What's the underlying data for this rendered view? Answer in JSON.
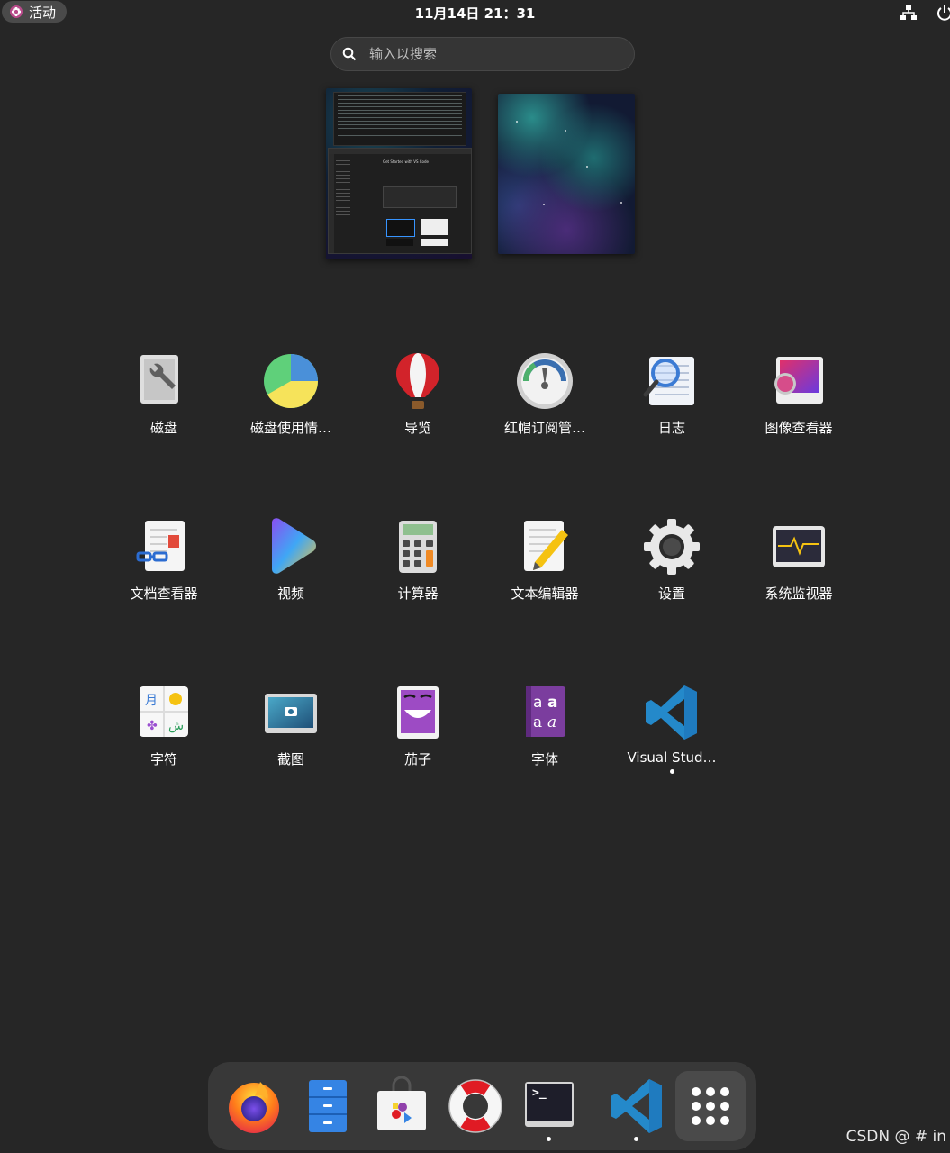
{
  "topbar": {
    "activities_label": "活动",
    "clock": "11月14日  21：31",
    "network_icon": "network-icon",
    "power_icon": "power-icon"
  },
  "search": {
    "placeholder": "输入以搜索"
  },
  "workspaces": [
    {
      "name": "workspace-1",
      "content": "Get Started with VS Code"
    },
    {
      "name": "workspace-2"
    }
  ],
  "apps": [
    {
      "label": "磁盘",
      "icon": "disks-icon"
    },
    {
      "label": "磁盘使用情…",
      "icon": "disk-usage-icon"
    },
    {
      "label": "导览",
      "icon": "tour-balloon-icon"
    },
    {
      "label": "红帽订阅管…",
      "icon": "subscription-gauge-icon"
    },
    {
      "label": "日志",
      "icon": "logs-icon"
    },
    {
      "label": "图像查看器",
      "icon": "image-viewer-icon"
    },
    {
      "label": "文档查看器",
      "icon": "document-viewer-icon"
    },
    {
      "label": "视频",
      "icon": "video-play-icon"
    },
    {
      "label": "计算器",
      "icon": "calculator-icon"
    },
    {
      "label": "文本编辑器",
      "icon": "text-editor-icon"
    },
    {
      "label": "设置",
      "icon": "settings-gear-icon"
    },
    {
      "label": "系统监视器",
      "icon": "system-monitor-icon"
    },
    {
      "label": "字符",
      "icon": "characters-icon"
    },
    {
      "label": "截图",
      "icon": "screenshot-icon"
    },
    {
      "label": "茄子",
      "icon": "cheese-icon"
    },
    {
      "label": "字体",
      "icon": "fonts-icon"
    },
    {
      "label": "Visual Stud…",
      "icon": "vscode-icon",
      "running": true
    }
  ],
  "dock": [
    {
      "name": "firefox",
      "icon": "firefox-icon"
    },
    {
      "name": "files",
      "icon": "files-cabinet-icon"
    },
    {
      "name": "software",
      "icon": "software-bag-icon"
    },
    {
      "name": "help",
      "icon": "help-lifebuoy-icon"
    },
    {
      "name": "terminal",
      "icon": "terminal-icon",
      "running": true,
      "glyph": ">_"
    },
    {
      "name": "vscode",
      "icon": "vscode-icon",
      "running": true
    },
    {
      "name": "show-apps",
      "icon": "app-grid-icon"
    }
  ],
  "watermark": "CSDN @ # in",
  "colors": {
    "background": "#262626",
    "dock": "#383838",
    "vscode_blue": "#2489ca"
  }
}
